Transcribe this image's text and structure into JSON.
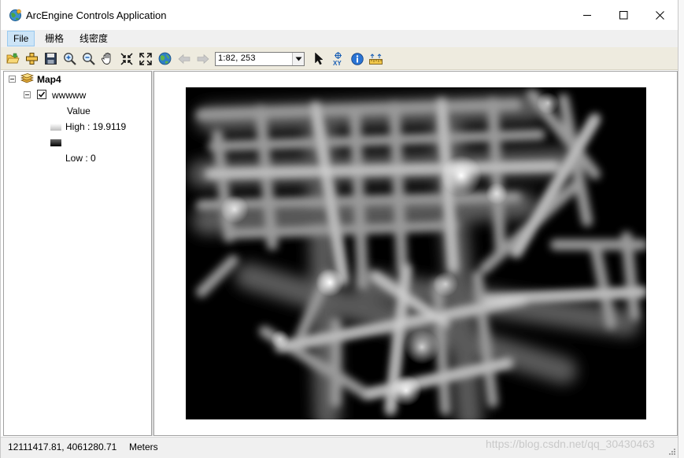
{
  "window": {
    "title": "ArcEngine Controls Application",
    "icon": "globe-app-icon",
    "controls": [
      "minimize-icon",
      "maximize-icon",
      "close-icon"
    ]
  },
  "menu": {
    "items": [
      {
        "label": "File",
        "active": true
      },
      {
        "label": "栅格",
        "active": false
      },
      {
        "label": "线密度",
        "active": false
      }
    ]
  },
  "toolbar": {
    "buttons": [
      "open-icon",
      "add-data-icon",
      "save-icon",
      "zoom-in-icon",
      "zoom-out-icon",
      "pan-icon",
      "fixed-zoom-in-icon",
      "full-extent-icon",
      "globe-icon",
      "back-arrow-icon",
      "forward-arrow-icon",
      "select-arrow-icon",
      "goto-xy-icon",
      "identify-icon",
      "measure-icon"
    ],
    "scale": {
      "value": "1:82, 253"
    }
  },
  "toc": {
    "map_name": "Map4",
    "layer": {
      "name": "wwwww",
      "checked": true,
      "legend_heading": "Value",
      "high_label": "High : 19.9119",
      "low_label": "Low : 0"
    }
  },
  "status": {
    "coordinates": "12111417.81, 4061280.71",
    "units": "Meters"
  },
  "watermark": "https://blog.csdn.net/qq_30430463",
  "colors": {
    "toolbar_bg": "#eeebdf",
    "menu_active": "#cce4f7",
    "raster_bg": "#000000",
    "raster_high": "#ffffff"
  }
}
